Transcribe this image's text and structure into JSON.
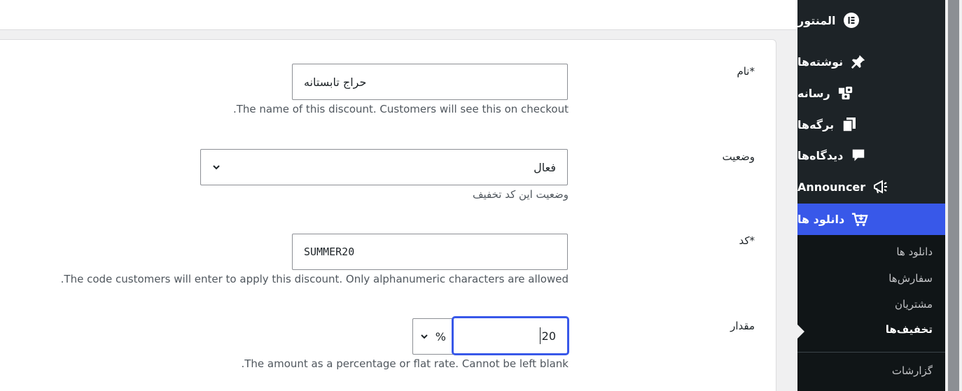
{
  "form": {
    "name": {
      "label": "نام*",
      "value": "حراج تابستانه",
      "hint": ".The name of this discount. Customers will see this on checkout"
    },
    "status": {
      "label": "وضعیت",
      "value": "فعال",
      "hint": "وضعیت این کد تخفیف"
    },
    "code": {
      "label": "کد*",
      "value": "SUMMER20",
      "hint": ".The code customers will enter to apply this discount. Only alphanumeric characters are allowed"
    },
    "amount": {
      "label": "مقدار",
      "value": "20",
      "type_value": "%",
      "hint": ".The amount as a percentage or flat rate. Cannot be left blank"
    }
  },
  "sidebar": {
    "items": [
      {
        "label": "المنتور",
        "icon": "elementor-icon"
      },
      {
        "label": "نوشته‌ها",
        "icon": "pin-icon"
      },
      {
        "label": "رسانه",
        "icon": "media-icon"
      },
      {
        "label": "برگه‌ها",
        "icon": "pages-icon"
      },
      {
        "label": "دیدگاه‌ها",
        "icon": "comment-icon"
      },
      {
        "label": "Announcer",
        "icon": "megaphone-icon"
      },
      {
        "label": "دانلود ها",
        "icon": "cart-download-icon"
      }
    ],
    "submenu": [
      {
        "label": "دانلود ها"
      },
      {
        "label": "سفارش‌ها"
      },
      {
        "label": "مشتریان"
      },
      {
        "label": "تخفیف‌ها"
      }
    ],
    "after": [
      {
        "label": "گزارشات"
      }
    ]
  },
  "colors": {
    "accent": "#3858e9",
    "sidebar_bg": "#1d2327"
  }
}
